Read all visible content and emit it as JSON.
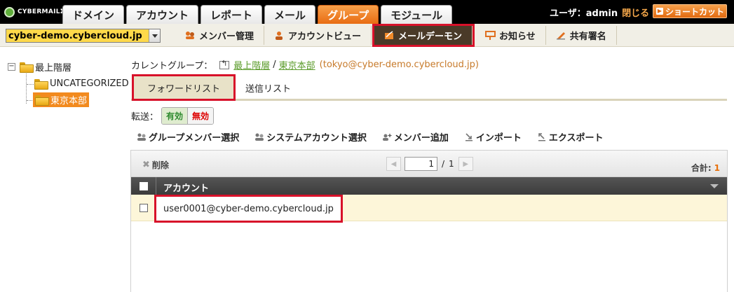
{
  "app": {
    "logo_text": "CYBERMAILΣ"
  },
  "top_tabs": [
    {
      "label": "ドメイン",
      "active": false
    },
    {
      "label": "アカウント",
      "active": false
    },
    {
      "label": "レポート",
      "active": false
    },
    {
      "label": "メール",
      "active": false
    },
    {
      "label": "グループ",
      "active": true
    },
    {
      "label": "モジュール",
      "active": false
    }
  ],
  "user": {
    "label": "ユーザ：admin",
    "close": "閉じる",
    "shortcut": "ショートカット"
  },
  "domain": {
    "selected": "cyber-demo.cybercloud.jp"
  },
  "sub_nav": [
    {
      "label": "メンバー管理",
      "icon": "members-icon",
      "highlight": false
    },
    {
      "label": "アカウントビュー",
      "icon": "account-view-icon",
      "highlight": false
    },
    {
      "label": "メールデーモン",
      "icon": "mail-daemon-icon",
      "highlight": true
    },
    {
      "label": "お知らせ",
      "icon": "notice-icon",
      "highlight": false
    },
    {
      "label": "共有署名",
      "icon": "signature-icon",
      "highlight": false
    }
  ],
  "tree": {
    "root": "最上階層",
    "children": [
      "UNCATEGORIZED",
      "東京本部"
    ],
    "selected": "東京本部"
  },
  "breadcrumb": {
    "label": "カレントグループ：",
    "root": "最上階層",
    "separator": "/",
    "current": "東京本部",
    "email": "(tokyo@cyber-demo.cybercloud.jp)"
  },
  "list_tabs": {
    "forward": "フォワードリスト",
    "send": "送信リスト"
  },
  "transfer": {
    "label": "転送：",
    "on": "有効",
    "off": "無効"
  },
  "actions": [
    "グループメンバー選択",
    "システムアカウント選択",
    "メンバー追加",
    "インポート",
    "エクスポート"
  ],
  "grid": {
    "delete": "削除",
    "page": "1",
    "page_sep": "/",
    "total_pages": "1",
    "total_label": "合計:",
    "total": "1",
    "column": "アカウント",
    "rows": [
      "user0001@cyber-demo.cybercloud.jp"
    ]
  },
  "colors": {
    "accent": "#e86c12",
    "highlight_border": "#d8112a",
    "link": "#5a9b2a"
  }
}
